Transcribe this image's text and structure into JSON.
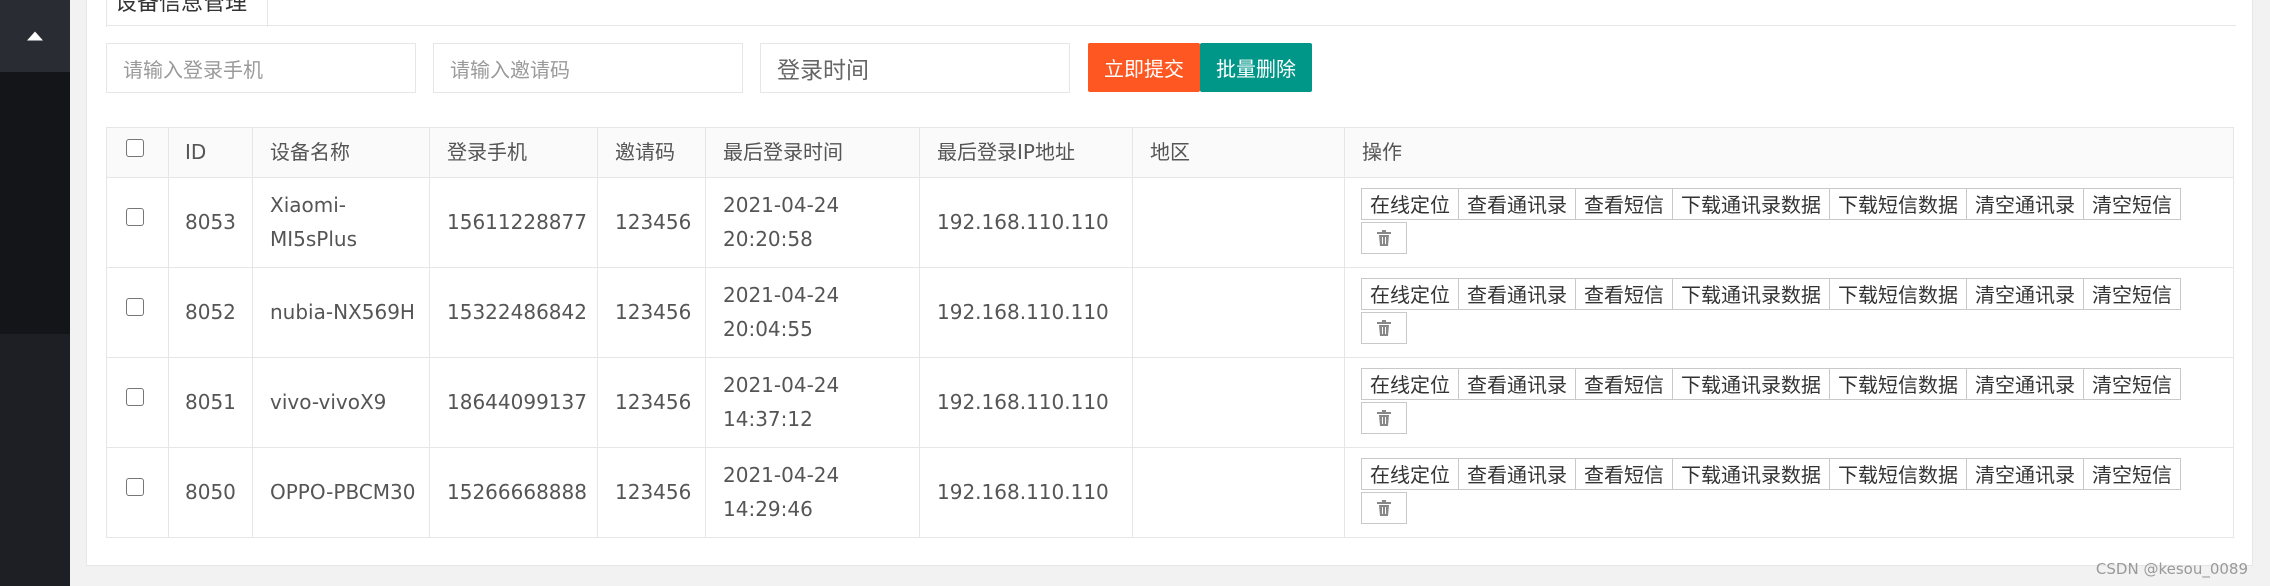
{
  "tab": {
    "label": "设备信息管理"
  },
  "search": {
    "phone_placeholder": "请输入登录手机",
    "invite_placeholder": "请输入邀请码",
    "time_placeholder": "登录时间"
  },
  "toolbar": {
    "submit_label": "立即提交",
    "batch_delete_label": "批量删除"
  },
  "table": {
    "headers": [
      "ID",
      "设备名称",
      "登录手机",
      "邀请码",
      "最后登录时间",
      "最后登录IP地址",
      "地区",
      "操作"
    ],
    "actions": [
      "在线定位",
      "查看通讯录",
      "查看短信",
      "下载通讯录数据",
      "下载短信数据",
      "清空通讯录",
      "清空短信"
    ],
    "rows": [
      {
        "id": "8053",
        "device_line1": "Xiaomi-",
        "device_line2": "MI5sPlus",
        "phone": "15611228877",
        "invite": "123456",
        "date": "2021-04-24",
        "time": "20:20:58",
        "ip": "192.168.110.110",
        "region": ""
      },
      {
        "id": "8052",
        "device_line1": "nubia-NX569H",
        "device_line2": "",
        "phone": "15322486842",
        "invite": "123456",
        "date": "2021-04-24",
        "time": "20:04:55",
        "ip": "192.168.110.110",
        "region": ""
      },
      {
        "id": "8051",
        "device_line1": "vivo-vivoX9",
        "device_line2": "",
        "phone": "18644099137",
        "invite": "123456",
        "date": "2021-04-24",
        "time": "14:37:12",
        "ip": "192.168.110.110",
        "region": ""
      },
      {
        "id": "8050",
        "device_line1": "OPPO-PBCM30",
        "device_line2": "",
        "phone": "15266668888",
        "invite": "123456",
        "date": "2021-04-24",
        "time": "14:29:46",
        "ip": "192.168.110.110",
        "region": ""
      }
    ]
  },
  "watermark": "CSDN @kesou_0089",
  "icons": {
    "collapse": "chevron-up-icon",
    "delete": "trash-icon"
  }
}
